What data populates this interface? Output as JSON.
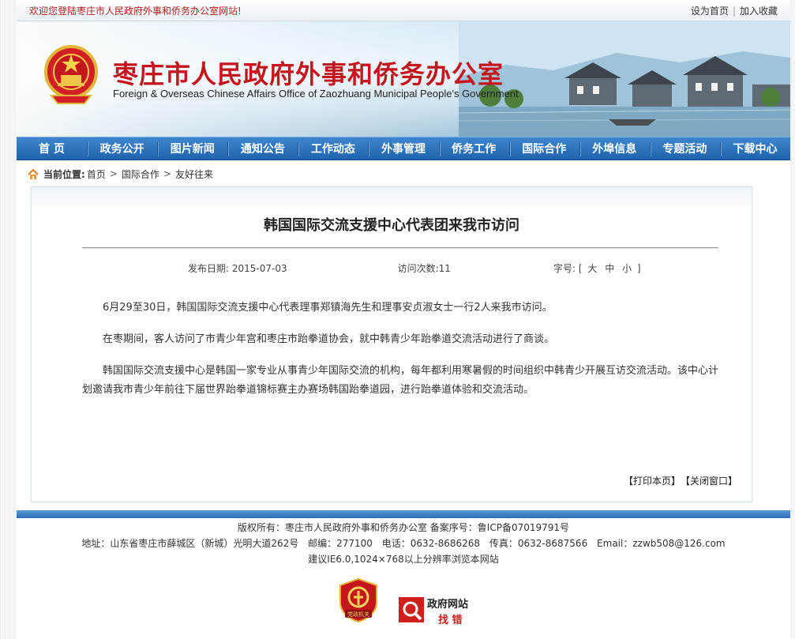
{
  "topbar": {
    "welcome": "欢迎您登陆枣庄市人民政府外事和侨务办公室网站!",
    "set_home": "设为首页",
    "separator": "|",
    "favorite": "加入收藏"
  },
  "banner": {
    "cn_title": "枣庄市人民政府外事和侨务办公室",
    "en_title": "Foreign & Overseas Chinese Affairs Office of Zaozhuang Municipal People's Government"
  },
  "nav": {
    "items": [
      "首 页",
      "政务公开",
      "图片新闻",
      "通知公告",
      "工作动态",
      "外事管理",
      "侨务工作",
      "国际合作",
      "外埠信息",
      "专题活动",
      "下载中心"
    ]
  },
  "breadcrumb": {
    "label": "当前位置:",
    "items": [
      "首页",
      "国际合作",
      "友好往来"
    ],
    "sep": ">"
  },
  "article": {
    "title": "韩国国际交流支援中心代表团来我市访问",
    "date_label": "发布日期:",
    "date": "2015-07-03",
    "views_label": "访问次数:",
    "views": "11",
    "size_label": "字号:",
    "size_open": "[",
    "size_large": "大",
    "size_medium": "中",
    "size_small": "小",
    "size_close": "]",
    "paragraphs": [
      "6月29至30日，韩国国际交流支援中心代表理事郑镇海先生和理事安贞淑女士一行2人来我市访问。",
      "在枣期间，客人访问了市青少年宫和枣庄市跆拳道协会，就中韩青少年跆拳道交流活动进行了商谈。",
      "韩国国际交流支援中心是韩国一家专业从事青少年国际交流的机构，每年都利用寒暑假的时间组织中韩青少开展互访交流活动。该中心计划邀请我市青少年前往下届世界跆拳道锦标赛主办赛场韩国跆拳道园，进行跆拳道体验和交流活动。"
    ],
    "print": "【打印本页】",
    "close": "【关闭窗口】"
  },
  "footer": {
    "copyright": "版权所有：枣庄市人民政府外事和侨务办公室 备案序号：鲁ICP备07019791号",
    "address": "地址：山东省枣庄市薛城区（新城）光明大道262号",
    "postcode": "邮编：277100",
    "phone": "电话：0632-8686268",
    "fax": "传真：0632-8687566",
    "email": "Email：zzwb508@126.com",
    "browser": "建议IE6.0,1024×768以上分辨率浏览本网站",
    "badge_text": "党政机关",
    "error_line1": "政府网站",
    "error_line2": "找 错"
  },
  "colors": {
    "brand_red": "#c4161c",
    "nav_blue": "#2a6cb6"
  }
}
